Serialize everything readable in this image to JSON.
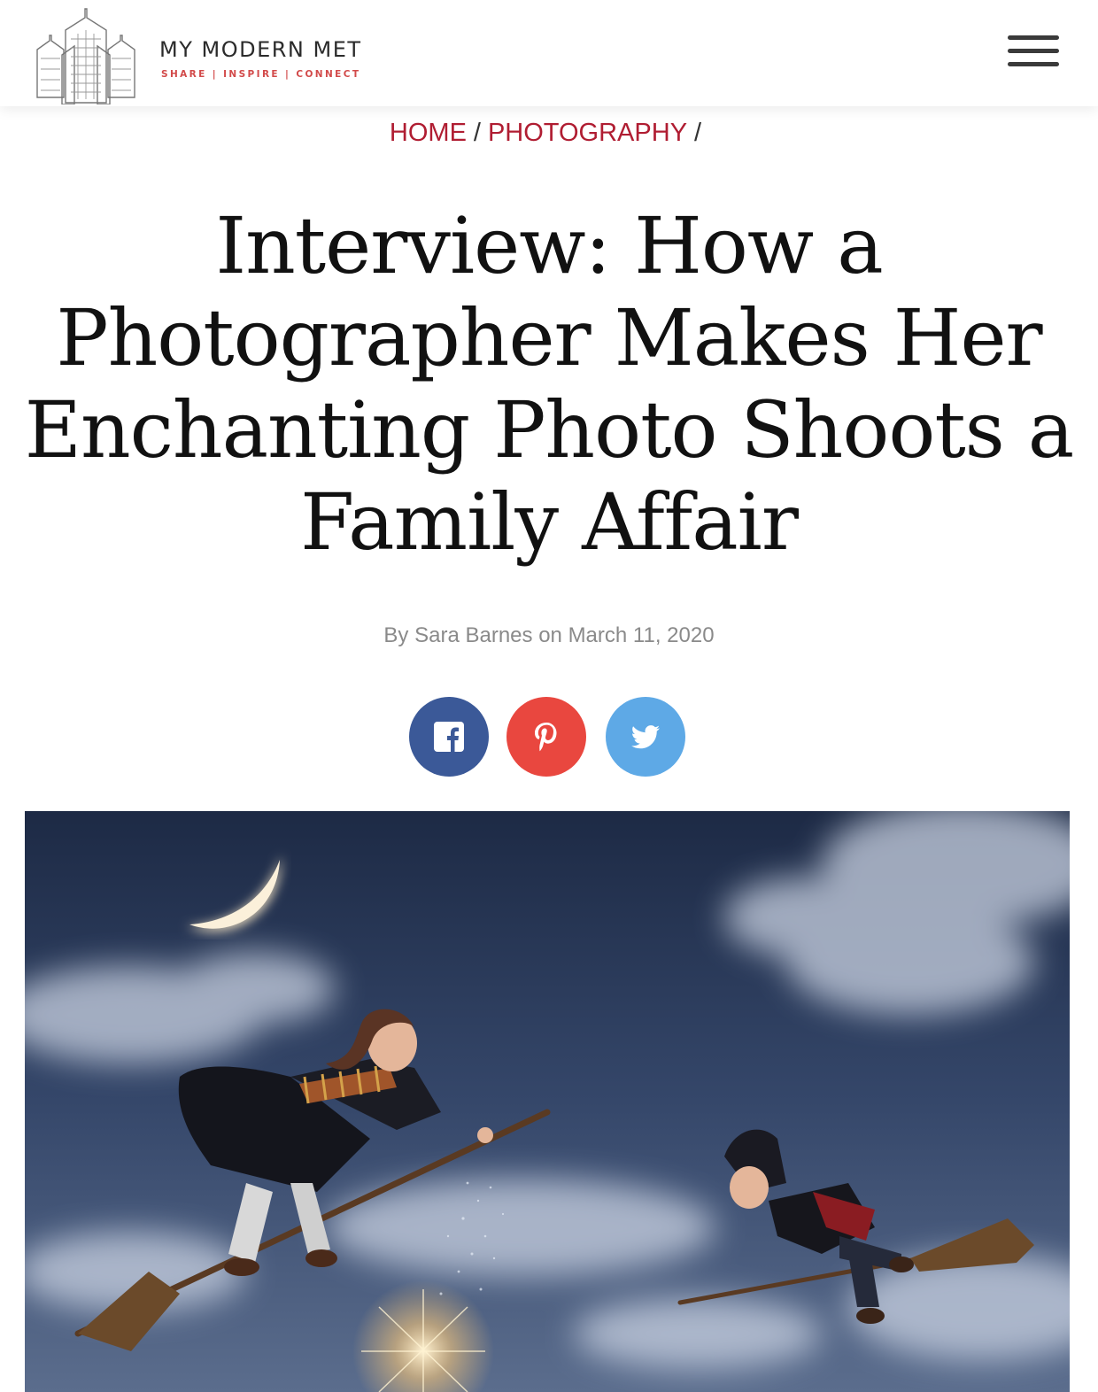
{
  "site": {
    "name": "MY MODERN MET",
    "tagline": "SHARE | INSPIRE | CONNECT"
  },
  "header": {
    "menu_icon": "hamburger-menu-icon"
  },
  "breadcrumb": {
    "items": [
      {
        "label": "HOME"
      },
      {
        "label": "PHOTOGRAPHY"
      }
    ],
    "separator": "/"
  },
  "article": {
    "title": "Interview: How a Photographer Makes Her Enchanting Photo Shoots a Family Affair",
    "byline_prefix": "By",
    "author": "Sara Barnes",
    "byline_on": "on",
    "date": "March 11, 2020"
  },
  "share": [
    {
      "network": "facebook",
      "icon": "facebook-icon",
      "color": "#3b5998"
    },
    {
      "network": "pinterest",
      "icon": "pinterest-icon",
      "color": "#e9473f"
    },
    {
      "network": "twitter",
      "icon": "twitter-icon",
      "color": "#5ea9e6"
    }
  ],
  "colors": {
    "accent": "#b01d32",
    "tagline": "#d24a4a"
  }
}
